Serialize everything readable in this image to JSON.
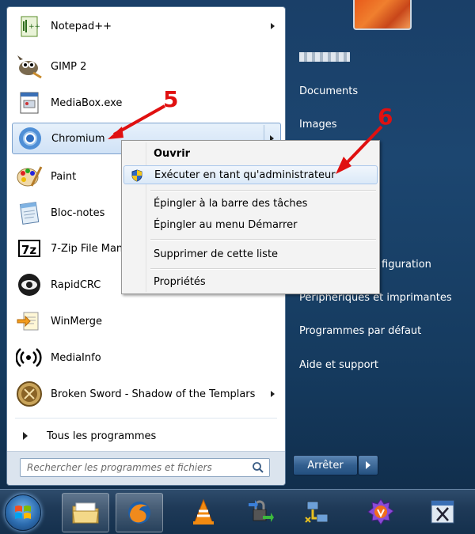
{
  "start_menu": {
    "programs": [
      {
        "label": "Notepad++",
        "icon": "notepadpp-icon",
        "has_submenu": true
      },
      {
        "label": "GIMP 2",
        "icon": "gimp-icon",
        "has_submenu": false
      },
      {
        "label": "MediaBox.exe",
        "icon": "mediabox-icon",
        "has_submenu": false
      },
      {
        "label": "Chromium",
        "icon": "chromium-icon",
        "has_submenu": true
      },
      {
        "label": "Paint",
        "icon": "paint-icon",
        "has_submenu": false
      },
      {
        "label": "Bloc-notes",
        "icon": "notepad-icon",
        "has_submenu": false
      },
      {
        "label": "7-Zip File Manager",
        "icon": "7zip-icon",
        "has_submenu": false
      },
      {
        "label": "RapidCRC",
        "icon": "rapidcrc-icon",
        "has_submenu": false
      },
      {
        "label": "WinMerge",
        "icon": "winmerge-icon",
        "has_submenu": false
      },
      {
        "label": "MediaInfo",
        "icon": "mediainfo-icon",
        "has_submenu": false
      },
      {
        "label": "Broken Sword - Shadow of the Templars",
        "icon": "broken-sword-icon",
        "has_submenu": true
      }
    ],
    "all_programs_label": "Tous les programmes",
    "search_placeholder": "Rechercher les programmes et fichiers",
    "right_links": {
      "documents": "Documents",
      "images": "Images",
      "config": "figuration",
      "devices": "Périphériques et imprimantes",
      "default_programs": "Programmes par défaut",
      "help": "Aide et support"
    },
    "shutdown_label": "Arrêter"
  },
  "context_menu": {
    "items": [
      {
        "label": "Ouvrir",
        "bold": true
      },
      {
        "label": "Exécuter en tant qu'administrateur",
        "highlighted": true
      },
      {
        "label": "Épingler à la barre des tâches"
      },
      {
        "label": "Épingler au menu Démarrer"
      },
      {
        "label": "Supprimer de cette liste"
      },
      {
        "label": "Propriétés"
      }
    ]
  },
  "annotations": {
    "step_5": "5",
    "step_6": "6",
    "color": "#e01010"
  },
  "taskbar": {
    "items": [
      "windows-explorer-icon",
      "firefox-icon",
      "vlc-icon",
      "network-tool-icon",
      "network-transfer-icon",
      "poweriso-icon",
      "scissors-app-icon"
    ]
  }
}
